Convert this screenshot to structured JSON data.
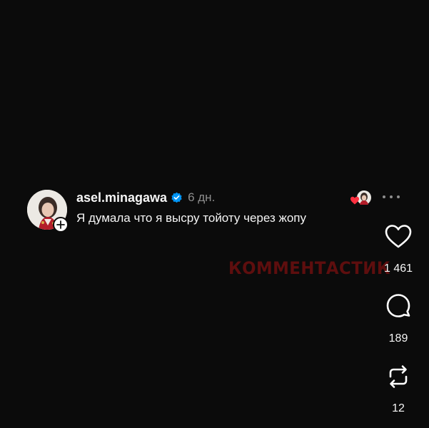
{
  "post": {
    "username": "asel.minagawa",
    "time": "6 дн.",
    "text": "Я думала что я высру тойоту через жопу"
  },
  "actions": {
    "likes": "1 461",
    "comments": "189",
    "reposts": "12"
  },
  "watermark": "КОММЕНТАСТИК",
  "icons": {
    "avatar": "avatar-photo",
    "follow": "plus-icon",
    "verified": "verified-badge-icon",
    "liked_by": "liked-by-avatar",
    "more": "more-horizontal-icon",
    "like": "heart-icon",
    "comment": "comment-bubble-icon",
    "repost": "repost-icon"
  },
  "colors": {
    "background": "#0b0b0b",
    "verified": "#0095f6",
    "like_heart": "#ff3040",
    "muted": "#8e8e8e"
  }
}
